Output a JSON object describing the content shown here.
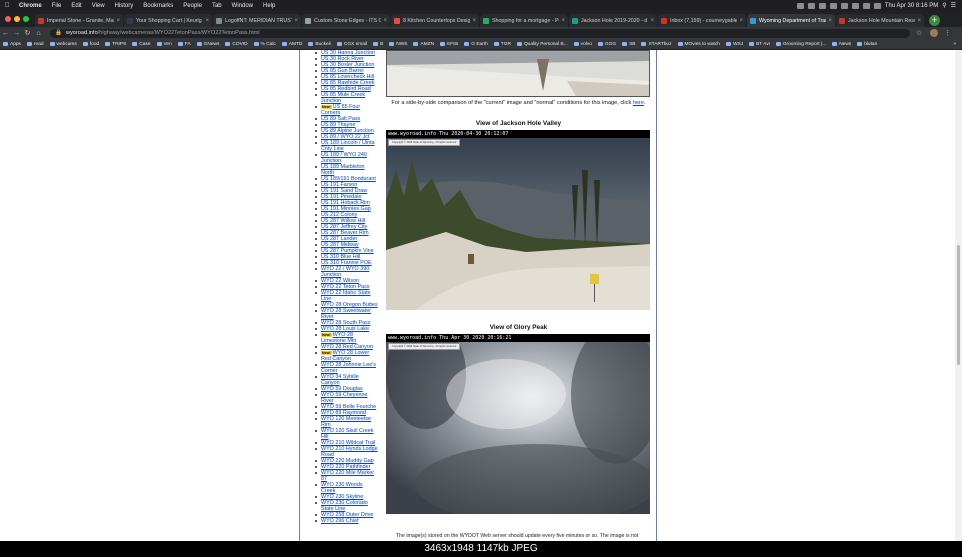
{
  "menubar": {
    "items": [
      "Chrome",
      "File",
      "Edit",
      "View",
      "History",
      "Bookmarks",
      "People",
      "Tab",
      "Window",
      "Help"
    ],
    "clock": "Thu Apr 30  8:16 PM"
  },
  "tabs": [
    {
      "title": "Imperial Stone - Granite, Marb",
      "color": "#c0392b"
    },
    {
      "title": "Your Shopping Cart | Keurig",
      "color": "#2c3e50"
    },
    {
      "title": "LogoffNT: MERIDIAN TRUST F",
      "color": "#7f8c8d"
    },
    {
      "title": "Custom Stone Edges - ITS Co",
      "color": "#95a5a6"
    },
    {
      "title": "8 Kitchen Countertops Design",
      "color": "#e74c3c"
    },
    {
      "title": "Shopping for a mortgage - Pos",
      "color": "#27ae60"
    },
    {
      "title": "Jackson Hole 2019-2020 - d",
      "color": "#16a085"
    },
    {
      "title": "Inbox (7,159) - courneygable",
      "color": "#d93025"
    },
    {
      "title": "Wyoming Department of Trans",
      "color": "#3498db",
      "active": true
    },
    {
      "title": "Jackson Hole Mountain Resort",
      "color": "#c0392b"
    }
  ],
  "address": {
    "host": "wyoroad.info",
    "path": "/highway/webcameras/WYO22TetonPass/WYO22TetonPass.html"
  },
  "bookmarks": [
    "Apps",
    "read",
    "webcams",
    "food",
    "TRIPS",
    "Case",
    "Ven",
    "FA",
    "GNews",
    "COVID",
    "% Calc",
    "AMTD",
    "Buckeli",
    "CGX email",
    "B",
    "NWS",
    "AMZN",
    "EFIts",
    "G Earth",
    "TGR",
    "Quality Personal B...",
    "volvo",
    "GGG",
    "SB",
    "STARTbuz",
    "MOvies to watch",
    "WSJ",
    "BT Avi",
    "Grooming Report |...",
    "News",
    "blutan"
  ],
  "sidebar": [
    {
      "label": "US 30 Hanna Junction"
    },
    {
      "label": "US 30 Rock River"
    },
    {
      "label": "US 30 Bosler Junction"
    },
    {
      "label": "US 85 Gun Barrel"
    },
    {
      "label": "US 85 Lovercheck Hill"
    },
    {
      "label": "US 85 Rawhide Creek"
    },
    {
      "label": "US 85 Redbird Road"
    },
    {
      "label": "US 85 Mule Creek Junction"
    },
    {
      "label": "US 85 Four Corners",
      "new": true
    },
    {
      "label": "US 89 Salt Pass"
    },
    {
      "label": "US 89 Thayne"
    },
    {
      "label": "US 89 Alpine Junction"
    },
    {
      "label": "US 89 / WYO 22 Jct"
    },
    {
      "label": "US 189 Lincoln / Uinta Cnty Line"
    },
    {
      "label": "US 189 / WYO 240 Junction"
    },
    {
      "label": "US 189 Marbleton North"
    },
    {
      "label": "US 189/191 Bondurant"
    },
    {
      "label": "US 191 Farson"
    },
    {
      "label": "US 191 Sand Draw"
    },
    {
      "label": "US 191 Pinedale"
    },
    {
      "label": "US 191 Hoback Rim"
    },
    {
      "label": "US 191 Minnies Gap"
    },
    {
      "label": "US 212 Colony"
    },
    {
      "label": "US 287 Willow Hill"
    },
    {
      "label": "US 287 Jeffrey City"
    },
    {
      "label": "US 287 Beaver Rim"
    },
    {
      "label": "US 287 Lander"
    },
    {
      "label": "US 287 Midway"
    },
    {
      "label": "US 287 Pumpkin Vine"
    },
    {
      "label": "US 310 Blue Hill"
    },
    {
      "label": "US 310 Frannie POE"
    },
    {
      "label": "WYO 22 / WYO 390 Junction"
    },
    {
      "label": "WYO 22 Wilson"
    },
    {
      "label": "WYO 22 Teton Pass"
    },
    {
      "label": "WYO 22 Idaho State Line"
    },
    {
      "label": "WYO 28 Oregon Buttes"
    },
    {
      "label": "WYO 28 Sweetwater River"
    },
    {
      "label": "WYO 28 South Pass"
    },
    {
      "label": "WYO 28 Louis Lake"
    },
    {
      "label": "WYO 28 Limestone Mtn",
      "new": true
    },
    {
      "label": "WYO 28 Red Canyon"
    },
    {
      "label": "WYO 28 Lower Red Canyon",
      "new": true
    },
    {
      "label": "WYO 28 Johnnie Lee's Corner"
    },
    {
      "label": "WYO 34 Sybille Canyon"
    },
    {
      "label": "WYO 59 Douglas"
    },
    {
      "label": "WYO 59 Cheyenne River"
    },
    {
      "label": "WYO 59 Belle Fourche"
    },
    {
      "label": "WYO 89 Raymond"
    },
    {
      "label": "WYO 120 Meeteetse Rim"
    },
    {
      "label": "WYO 120 Skull Creek Hill"
    },
    {
      "label": "WYO 210 Wildcat Trail"
    },
    {
      "label": "WYO 210 Hynds Lodge Road"
    },
    {
      "label": "WYO 220 Muddy Gap"
    },
    {
      "label": "WYO 220 Pathfinder"
    },
    {
      "label": "WYO 220 Mile Marker 87"
    },
    {
      "label": "WYO 230 Woods Creek"
    },
    {
      "label": "WYO 230 Skyline"
    },
    {
      "label": "WYO 230 Colorado State Line"
    },
    {
      "label": "WYO 258 Outer Drive"
    },
    {
      "label": "WYO 296 Chief"
    }
  ],
  "new_badge": "New!",
  "compare": {
    "text": "For a side-by-side comparison of the \"current\" image and \"normal\" conditions for this image, click ",
    "link": "here",
    "after": "."
  },
  "views": [
    {
      "title": "View of Jackson Hole Valley",
      "stamp": "www.wyoroad.info  Thu 2020-04-30 20:12:07",
      "copyright": "Copyright © 2020 State of Wyoming - All rights reserved"
    },
    {
      "title": "View of Glory Peak",
      "stamp": "www.wyoroad.info  Thu Apr 30 2020 20:16:21",
      "copyright": "Copyright © 2020 State of Wyoming - All rights reserved"
    }
  ],
  "bottom_text": "The image(s) stored on the WYDOT Web server should update every five minutes or so. The image is not",
  "caption": "3463x1948  1147kb  JPEG"
}
